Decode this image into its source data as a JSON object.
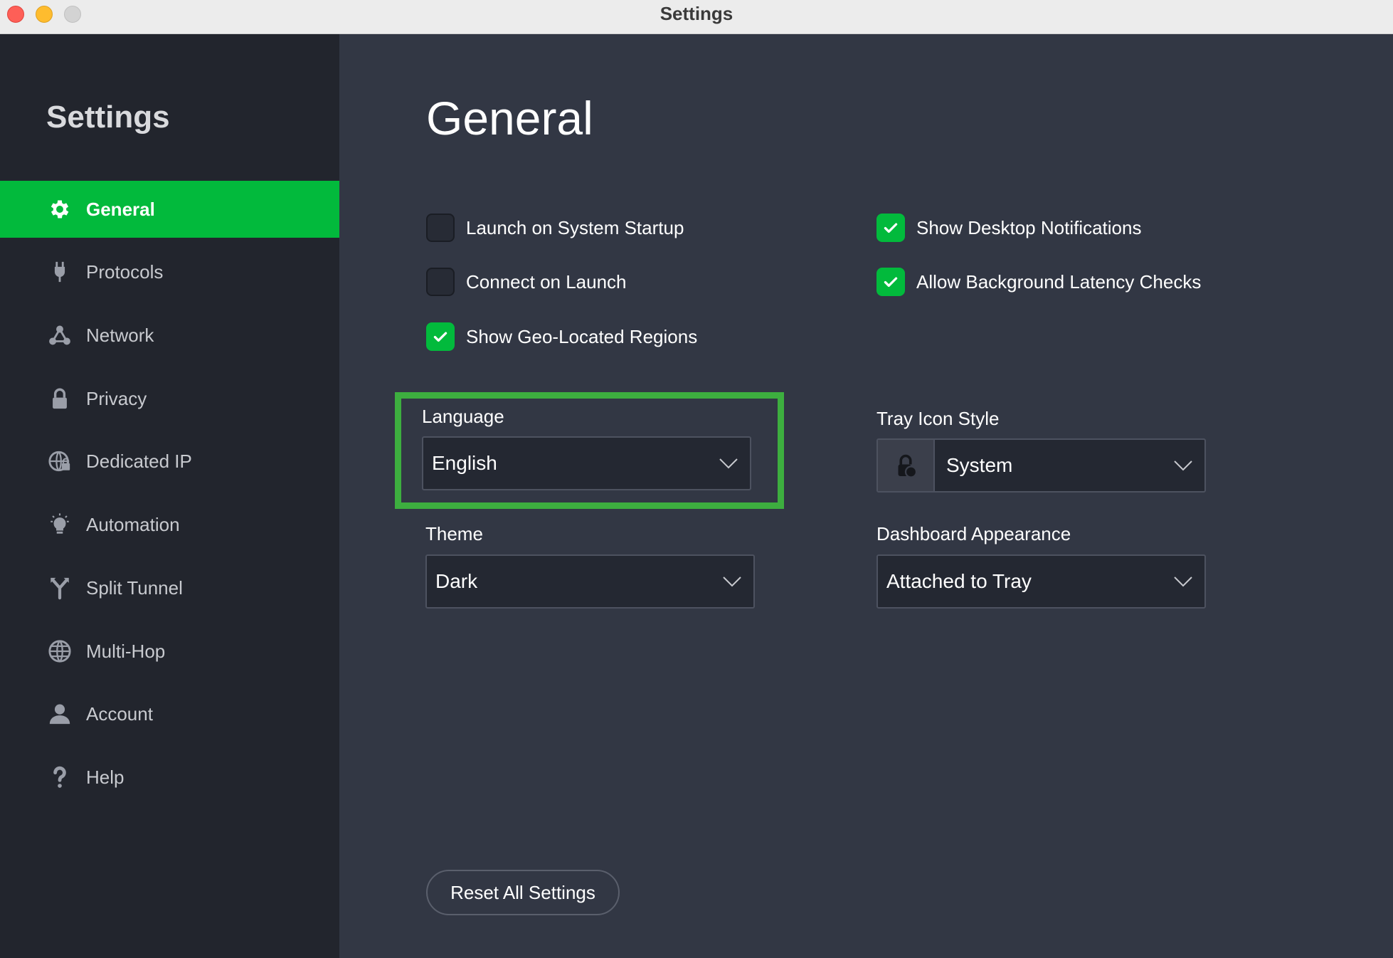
{
  "window": {
    "title": "Settings"
  },
  "sidebar": {
    "title": "Settings",
    "items": [
      {
        "label": "General",
        "icon": "gear-icon",
        "active": true
      },
      {
        "label": "Protocols",
        "icon": "plug-icon",
        "active": false
      },
      {
        "label": "Network",
        "icon": "network-icon",
        "active": false
      },
      {
        "label": "Privacy",
        "icon": "lock-icon",
        "active": false
      },
      {
        "label": "Dedicated IP",
        "icon": "globe-lock-icon",
        "active": false
      },
      {
        "label": "Automation",
        "icon": "lightbulb-icon",
        "active": false
      },
      {
        "label": "Split Tunnel",
        "icon": "split-icon",
        "active": false
      },
      {
        "label": "Multi-Hop",
        "icon": "globe-icon",
        "active": false
      },
      {
        "label": "Account",
        "icon": "user-icon",
        "active": false
      },
      {
        "label": "Help",
        "icon": "question-icon",
        "active": false
      }
    ]
  },
  "main": {
    "title": "General",
    "checkboxes": {
      "launch_on_startup": {
        "label": "Launch on System Startup",
        "checked": false
      },
      "connect_on_launch": {
        "label": "Connect on Launch",
        "checked": false
      },
      "show_geo_regions": {
        "label": "Show Geo-Located Regions",
        "checked": true
      },
      "show_desktop_notifications": {
        "label": "Show Desktop Notifications",
        "checked": true
      },
      "allow_background_latency": {
        "label": "Allow Background Latency Checks",
        "checked": true
      }
    },
    "language": {
      "label": "Language",
      "value": "English"
    },
    "tray_icon_style": {
      "label": "Tray Icon Style",
      "value": "System"
    },
    "theme": {
      "label": "Theme",
      "value": "Dark"
    },
    "dashboard_appearance": {
      "label": "Dashboard Appearance",
      "value": "Attached to Tray"
    },
    "reset_label": "Reset All Settings"
  },
  "colors": {
    "accent": "#02ba3c",
    "sidebar_bg": "#22252d",
    "main_bg": "#323744",
    "highlight": "#3dae3f"
  }
}
